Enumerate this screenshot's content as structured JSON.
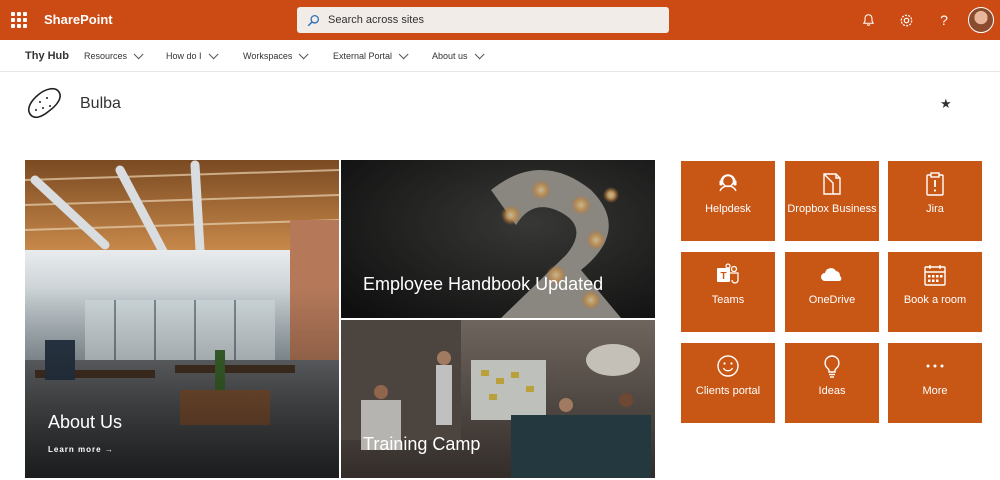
{
  "suitebar": {
    "brand": "SharePoint",
    "search_placeholder": "Search across sites",
    "icons": [
      "notifications-icon",
      "settings-icon",
      "help-icon"
    ]
  },
  "hubnav": {
    "hub_name": "Thy Hub",
    "items": [
      "Resources",
      "How do I",
      "Workspaces",
      "External Portal",
      "About us"
    ]
  },
  "site": {
    "title": "Bulba",
    "follow_icon": "star-icon"
  },
  "hero": {
    "main": {
      "title": "About Us",
      "link": "Learn more"
    },
    "top_right": {
      "title": "Employee Handbook Updated"
    },
    "bottom_right": {
      "title": "Training Camp"
    }
  },
  "quicklinks": [
    {
      "label": "Helpdesk",
      "icon": "headset-icon"
    },
    {
      "label": "Dropbox Business",
      "icon": "dropbox-icon"
    },
    {
      "label": "Jira",
      "icon": "clipboard-icon"
    },
    {
      "label": "Teams",
      "icon": "teams-icon"
    },
    {
      "label": "OneDrive",
      "icon": "cloud-icon"
    },
    {
      "label": "Book a room",
      "icon": "calendar-icon"
    },
    {
      "label": "Clients portal",
      "icon": "smiley-icon"
    },
    {
      "label": "Ideas",
      "icon": "lightbulb-icon"
    },
    {
      "label": "More",
      "icon": "more-icon"
    }
  ],
  "colors": {
    "suitebar": "#cc4a14",
    "tile": "#c85716"
  }
}
